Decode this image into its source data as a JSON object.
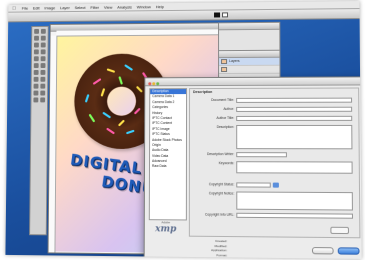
{
  "menubar": {
    "items": [
      "File",
      "Edit",
      "Image",
      "Layer",
      "Select",
      "Filter",
      "View",
      "Analysis",
      "Window",
      "Help"
    ],
    "clock": ""
  },
  "canvas": {
    "headline_line1": "DIGITAL DE",
    "headline_line2": "DONUT"
  },
  "layers_palette": {
    "rows": [
      {
        "label": "Layers"
      },
      {
        "label": ""
      },
      {
        "label": ""
      },
      {
        "label": ""
      }
    ]
  },
  "file_info": {
    "title": "",
    "categories": [
      "Description",
      "Camera Data 1",
      "Camera Data 2",
      "Categories",
      "History",
      "IPTC Contact",
      "IPTC Content",
      "IPTC Image",
      "IPTC Status",
      "Adobe Stock Photos",
      "Origin",
      "Audio Data",
      "Video Data",
      "Advanced",
      "Raw Data"
    ],
    "section_title": "Description",
    "fields": {
      "document_title_label": "Document Title:",
      "document_title_value": "",
      "author_label": "Author:",
      "author_value": "",
      "author_title_label": "Author Title:",
      "author_title_value": "",
      "description_label": "Description:",
      "description_value": "",
      "description_writer_label": "Description Writer:",
      "description_writer_value": "",
      "keywords_label": "Keywords:",
      "keywords_value": "",
      "keywords_note": "",
      "copyright_status_label": "Copyright Status:",
      "copyright_status_value": "",
      "copyright_notice_label": "Copyright Notice:",
      "copyright_notice_value": "",
      "copyright_url_label": "Copyright Info URL:",
      "copyright_url_value": "",
      "go_to_url_label": ""
    },
    "meta": [
      {
        "label": "Created:",
        "value": ""
      },
      {
        "label": "Modified:",
        "value": ""
      },
      {
        "label": "Application:",
        "value": ""
      },
      {
        "label": "Format:",
        "value": ""
      }
    ],
    "logo_small": "Adobe",
    "logo_text": "xmp",
    "buttons": {
      "cancel": "",
      "ok": ""
    }
  },
  "colors": {
    "desktop": "#1a4f9e",
    "selection": "#3875d7",
    "donut_text": "#1f5bb8"
  }
}
